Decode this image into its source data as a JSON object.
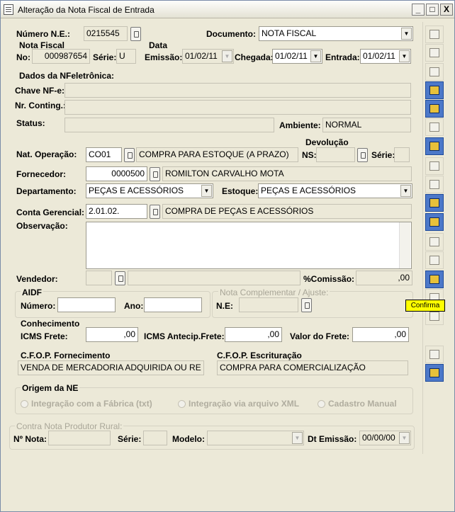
{
  "window": {
    "title": "Alteração da Nota Fiscal de Entrada",
    "min": "_",
    "max": "□",
    "close": "X"
  },
  "numero_ne": {
    "label": "Número N.E.:",
    "value": "0215545"
  },
  "documento": {
    "label": "Documento:",
    "value": "NOTA FISCAL"
  },
  "nota_fiscal": {
    "heading": "Nota Fiscal",
    "no_label": "No:",
    "no_value": "000987654",
    "serie_label": "Série:",
    "serie_value": "U"
  },
  "data": {
    "heading": "Data",
    "emissao_label": "Emissão:",
    "emissao_value": "01/02/11",
    "chegada_label": "Chegada:",
    "chegada_value": "01/02/11",
    "entrada_label": "Entrada:",
    "entrada_value": "01/02/11"
  },
  "nfe": {
    "heading": "Dados da NFeletrônica:",
    "chave_label": "Chave NF-e:",
    "chave_value": "",
    "contig_label": "Nr. Conting.:",
    "contig_value": "",
    "status_label": "Status:",
    "status_value": "",
    "ambiente_label": "Ambiente:",
    "ambiente_value": "NORMAL"
  },
  "devolucao": {
    "heading": "Devolução",
    "ns_label": "NS:",
    "serie_label": "Série:"
  },
  "nat_operacao": {
    "label": "Nat. Operação:",
    "code": "CO01",
    "desc": "COMPRA PARA ESTOQUE (A PRAZO)"
  },
  "fornecedor": {
    "label": "Fornecedor:",
    "code": "0000500",
    "name": "ROMILTON CARVALHO MOTA"
  },
  "departamento": {
    "label": "Departamento:",
    "value": "PEÇAS E ACESSÓRIOS"
  },
  "estoque": {
    "label": "Estoque:",
    "value": "PEÇAS E ACESSÓRIOS"
  },
  "conta_gerencial": {
    "label": "Conta Gerencial:",
    "code": "2.01.02.",
    "desc": "COMPRA DE PEÇAS E ACESSÓRIOS"
  },
  "observacao": {
    "label": "Observação:",
    "value": ""
  },
  "vendedor": {
    "label": "Vendedor:",
    "comissao_label": "%Comissão:",
    "comissao_value": ",00"
  },
  "aidf": {
    "heading": "AIDF",
    "numero_label": "Número:",
    "ano_label": "Ano:"
  },
  "nota_complementar": {
    "heading": "Nota Complementar / Ajuste:",
    "ne_label": "N.E:"
  },
  "conhecimento": {
    "heading": "Conhecimento",
    "icms_frete_label": "ICMS Frete:",
    "icms_frete_value": ",00",
    "icms_antecip_label": "ICMS Antecip.Frete:",
    "icms_antecip_value": ",00",
    "valor_frete_label": "Valor do Frete:",
    "valor_frete_value": ",00"
  },
  "cfop": {
    "fornecimento_label": "C.F.O.P. Fornecimento",
    "fornecimento_value": "VENDA DE MERCADORIA ADQUIRIDA OU RE",
    "escrituracao_label": "C.F.O.P. Escrituração",
    "escrituracao_value": "COMPRA PARA COMERCIALIZAÇÃO"
  },
  "origem": {
    "heading": "Origem da NE",
    "opt1": "Integração com a Fábrica (txt)",
    "opt2": "Integração via arquivo XML",
    "opt3": "Cadastro Manual"
  },
  "contra_nota": {
    "heading": "Contra Nota Produtor Rural:",
    "nota_label": "Nº Nota:",
    "serie_label": "Série:",
    "modelo_label": "Modelo:",
    "dt_label": "Dt Emissão:",
    "dt_value": "00/00/00"
  },
  "tooltip": "Confirma"
}
